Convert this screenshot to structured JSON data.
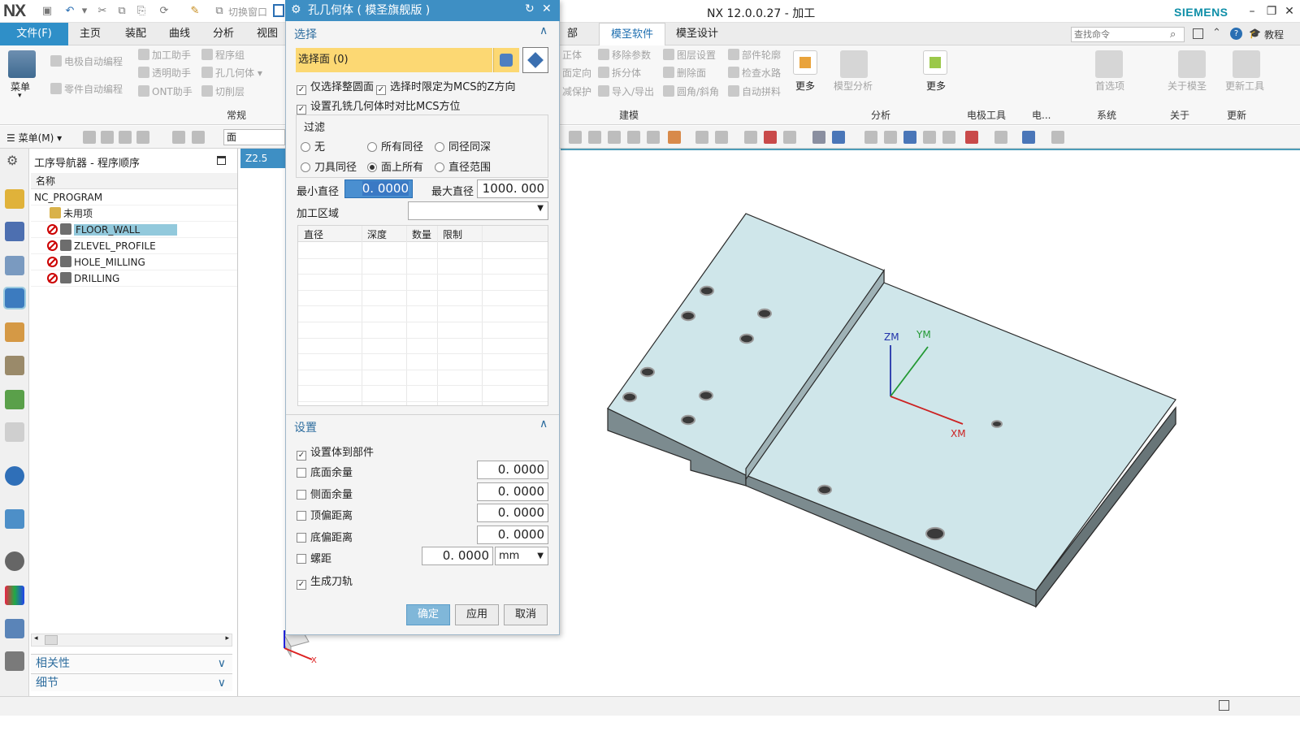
{
  "titlebar": {
    "logo": "NX",
    "switch_window": "切换窗口",
    "title": "NX 12.0.0.27 - 加工",
    "brand": "SIEMENS"
  },
  "menubar": {
    "file": "文件(F)",
    "tabs": [
      "主页",
      "装配",
      "曲线",
      "分析",
      "视图"
    ],
    "tab_partial": "部",
    "tab_active": "模圣软件",
    "tab_design": "模圣设计",
    "search_placeholder": "查找命令",
    "tutorial": "教程"
  },
  "ribbon": {
    "menu_label": "菜单",
    "items_left": [
      "电极自动编程",
      "加工助手",
      "程序组",
      "零件自动编程",
      "透明助手",
      "孔几何体",
      "ONT助手",
      "切削层"
    ],
    "group_general": "常规",
    "items_mid": [
      "正体",
      "移除参数",
      "图层设置",
      "部件轮廓",
      "面定向",
      "拆分体",
      "检查水路",
      "减保护",
      "导入/导出",
      "删除面",
      "圆角/斜角",
      "自动拼料"
    ],
    "more1": "更多",
    "group_modeling": "建模",
    "model_analysis": "模型分析",
    "more2": "更多",
    "group_analysis": "分析",
    "group_electrode": "电极工具",
    "group_elec2": "电...",
    "prefs": "首选项",
    "group_system": "系统",
    "about": "关于模圣",
    "group_about": "关于",
    "update_tool": "更新工具",
    "group_update": "更新"
  },
  "toolbar2": {
    "menu": "菜单(M)",
    "filter_value": "面"
  },
  "navigator": {
    "title": "工序导航器 - 程序顺序",
    "col_name": "名称",
    "root": "NC_PROGRAM",
    "unused": "未用项",
    "ops": [
      "FLOOR_WALL",
      "ZLEVEL_PROFILE",
      "HOLE_MILLING",
      "DRILLING"
    ],
    "section_relevance": "相关性",
    "section_detail": "细节"
  },
  "graphics_tab": "Z2.5",
  "dialog": {
    "title": "孔几何体  ( 模圣旗舰版 )",
    "section_select": "选择",
    "select_face": "选择面 (0)",
    "opt_whole_circle": "仅选择整圆面",
    "opt_limit_z": "选择时限定为MCS的Z方向",
    "opt_compare_mcs": "设置孔铣几何体时对比MCS方位",
    "filter_label": "过滤",
    "filter_opts": [
      "无",
      "所有同径",
      "同径同深",
      "刀具同径",
      "面上所有",
      "直径范围"
    ],
    "filter_selected": "面上所有",
    "min_dia_label": "最小直径",
    "min_dia": "0. 0000",
    "max_dia_label": "最大直径",
    "max_dia": "1000. 000",
    "area_label": "加工区域",
    "table_headers": [
      "直径",
      "深度",
      "数量",
      "限制"
    ],
    "section_settings": "设置",
    "set_body": "设置体到部件",
    "floor_stock": "底面余量",
    "floor_stock_val": "0. 0000",
    "side_stock": "侧面余量",
    "side_stock_val": "0. 0000",
    "top_offset": "顶偏距离",
    "top_offset_val": "0. 0000",
    "bottom_offset": "底偏距离",
    "bottom_offset_val": "0. 0000",
    "pitch": "螺距",
    "pitch_val": "0. 0000",
    "pitch_unit": "mm",
    "gen_path": "生成刀轨",
    "ok": "确定",
    "apply": "应用",
    "cancel": "取消"
  },
  "viewport": {
    "axis_zm": "ZM",
    "axis_ym": "YM",
    "axis_xm": "XM",
    "triad_x": "X",
    "part_top_color": "#cfe6ea",
    "part_side_color": "#7c8b8f"
  }
}
